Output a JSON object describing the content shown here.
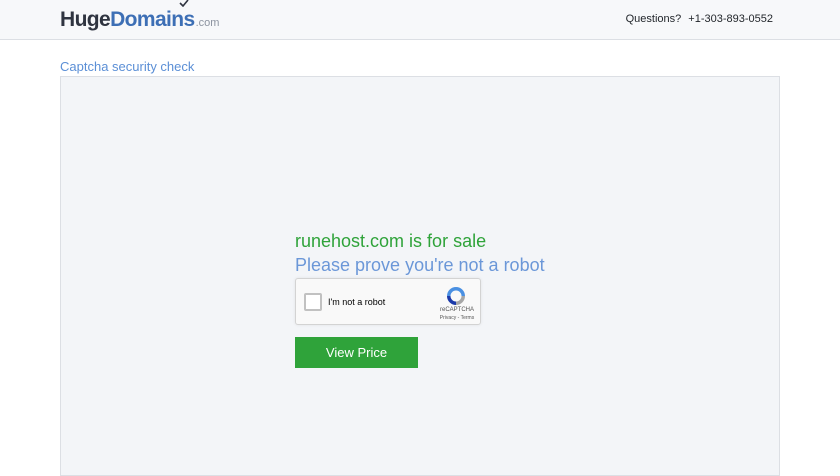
{
  "header": {
    "logo": {
      "part1": "Huge",
      "part2": "Domains",
      "part3": ".com"
    },
    "contact": {
      "label": "Questions?",
      "phone": "+1-303-893-0552"
    }
  },
  "section_title": "Captcha security check",
  "main": {
    "headline": "runehost.com is for sale",
    "subline": "Please prove you're not a robot",
    "recaptcha": {
      "label": "I'm not a robot",
      "brand": "reCAPTCHA",
      "privacy": "Privacy",
      "separator": "-",
      "terms": "Terms"
    },
    "view_price_label": "View Price"
  },
  "colors": {
    "accent_green": "#2fa33a",
    "accent_blue": "#5b8fd6",
    "logo_dark": "#2f3440"
  },
  "icons": [
    "checkmark-icon",
    "recaptcha-logo-icon"
  ]
}
